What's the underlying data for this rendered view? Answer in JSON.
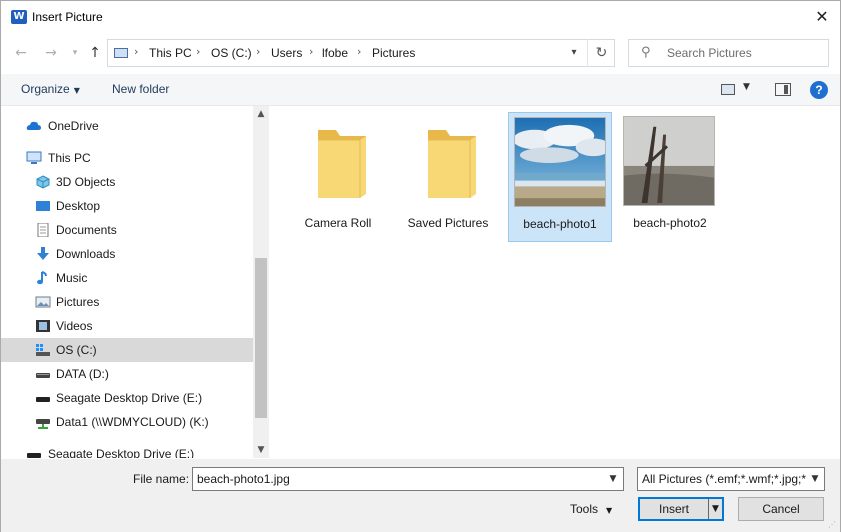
{
  "window": {
    "title": "Insert Picture",
    "app_icon": "W"
  },
  "nav": {
    "breadcrumbs": [
      "This PC",
      "OS (C:)",
      "Users",
      "lfobe",
      "Pictures"
    ],
    "search_placeholder": "Search Pictures"
  },
  "toolbar": {
    "organize_label": "Organize",
    "new_folder_label": "New folder"
  },
  "sidebar": {
    "items": [
      {
        "label": "OneDrive",
        "icon": "cloud-icon",
        "indent": 0
      },
      {
        "label": "This PC",
        "icon": "computer-icon",
        "indent": 0
      },
      {
        "label": "3D Objects",
        "icon": "cube-icon",
        "indent": 1
      },
      {
        "label": "Desktop",
        "icon": "desktop-icon",
        "indent": 1
      },
      {
        "label": "Documents",
        "icon": "document-icon",
        "indent": 1
      },
      {
        "label": "Downloads",
        "icon": "download-arrow-icon",
        "indent": 1
      },
      {
        "label": "Music",
        "icon": "music-note-icon",
        "indent": 1
      },
      {
        "label": "Pictures",
        "icon": "pictures-icon",
        "indent": 1
      },
      {
        "label": "Videos",
        "icon": "film-icon",
        "indent": 1
      },
      {
        "label": "OS (C:)",
        "icon": "os-drive-icon",
        "indent": 1,
        "selected": true
      },
      {
        "label": "DATA (D:)",
        "icon": "drive-icon",
        "indent": 1
      },
      {
        "label": "Seagate Desktop Drive (E:)",
        "icon": "drive-icon",
        "indent": 1
      },
      {
        "label": "Data1 (\\\\WDMYCLOUD) (K:)",
        "icon": "network-drive-icon",
        "indent": 1
      },
      {
        "label": "Seagate Desktop Drive (E:)",
        "icon": "drive-icon",
        "indent": 0
      }
    ]
  },
  "content": {
    "items": [
      {
        "label": "Camera Roll",
        "kind": "folder"
      },
      {
        "label": "Saved Pictures",
        "kind": "folder"
      },
      {
        "label": "beach-photo1",
        "kind": "image",
        "selected": true
      },
      {
        "label": "beach-photo2",
        "kind": "image"
      }
    ]
  },
  "bottom": {
    "file_name_label": "File name:",
    "file_name_value": "beach-photo1.jpg",
    "filter_label": "All Pictures (*.emf;*.wmf;*.jpg;*",
    "tools_label": "Tools",
    "insert_label": "Insert",
    "cancel_label": "Cancel"
  },
  "colors": {
    "accent": "#0078d7",
    "selection": "#cce4f7",
    "folder": "#f8d775"
  }
}
